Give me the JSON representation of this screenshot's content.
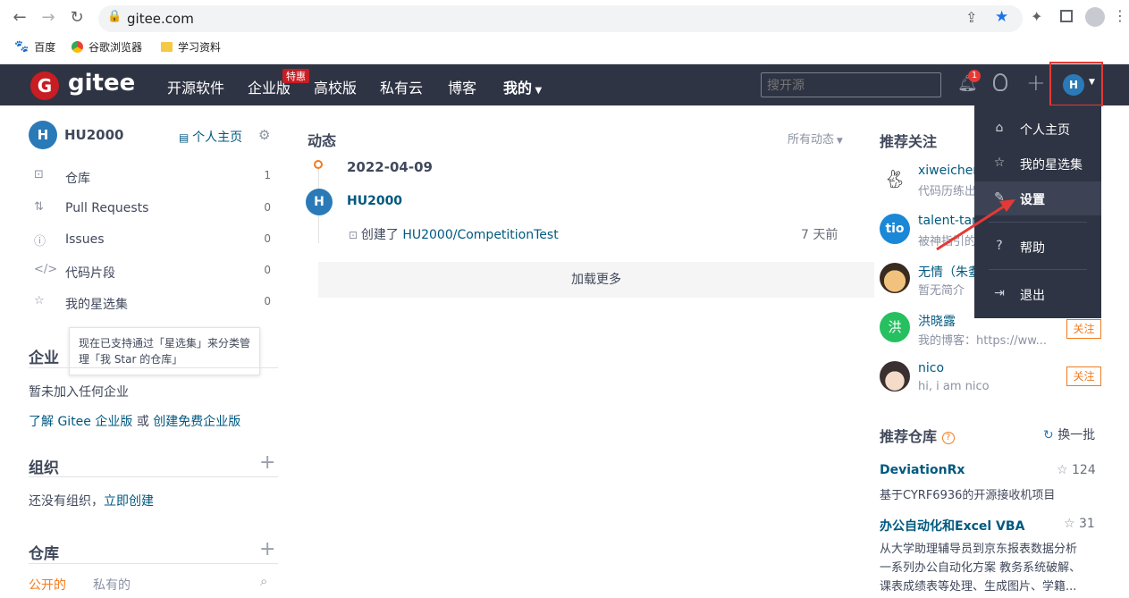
{
  "browser": {
    "url": "gitee.com",
    "bookmarks": [
      "百度",
      "谷歌浏览器",
      "学习资料"
    ]
  },
  "header": {
    "logo_text": "gitee",
    "nav": [
      "开源软件",
      "企业版",
      "高校版",
      "私有云",
      "博客",
      "我的"
    ],
    "promo_badge": "特惠",
    "search_placeholder": "搜开源",
    "notification_count": "1",
    "user_initial": "H"
  },
  "profile": {
    "initial": "H",
    "username": "HU2000",
    "home_link": "个人主页"
  },
  "sidebar": {
    "items": [
      {
        "icon": "repo-icon",
        "label": "仓库",
        "count": "1"
      },
      {
        "icon": "pull-request-icon",
        "label": "Pull Requests",
        "count": "0"
      },
      {
        "icon": "issue-icon",
        "label": "Issues",
        "count": "0"
      },
      {
        "icon": "code-icon",
        "label": "代码片段",
        "count": "0"
      },
      {
        "icon": "star-icon",
        "label": "我的星选集",
        "count": "0"
      }
    ],
    "tooltip": "现在已支持通过「星选集」来分类管理「我 Star 的仓库」",
    "enterprise_title": "企业",
    "enterprise_empty": "暂未加入任何企业",
    "enterprise_link1": "了解 Gitee 企业版",
    "enterprise_or": "或",
    "enterprise_link2": "创建免费企业版",
    "org_title": "组织",
    "org_empty": "还没有组织，",
    "org_link": "立即创建",
    "repo_title": "仓库",
    "repo_tab_public": "公开的",
    "repo_tab_private": "私有的"
  },
  "feed": {
    "title": "动态",
    "filter": "所有动态",
    "date": "2022-04-09",
    "user_initial": "H",
    "user": "HU2000",
    "action_prefix": "创建了",
    "action_repo": "HU2000/CompetitionTest",
    "time": "7 天前",
    "load_more": "加载更多"
  },
  "recommend_follow": {
    "title": "推荐关注",
    "users": [
      {
        "name": "xiweicheng",
        "desc": "代码历练出"
      },
      {
        "name": "talent-tan",
        "desc": "被神指引的"
      },
      {
        "name": "无情（朱耋",
        "desc": "暂无简介"
      },
      {
        "name": "洪晓露",
        "desc": "我的博客：https://ww..."
      },
      {
        "name": "nico",
        "desc": "hi, i am nico"
      }
    ],
    "follow_label": "关注",
    "hong_initial": "洪"
  },
  "recommend_repos": {
    "title": "推荐仓库",
    "refresh": "换一批",
    "repos": [
      {
        "name": "DeviationRx",
        "stars": "124",
        "desc": "基于CYRF6936的开源接收机项目"
      },
      {
        "name": "办公自动化和Excel VBA",
        "stars": "31",
        "desc_lines": [
          "从大学助理辅导员到京东报表数据分析",
          "一系列办公自动化方案 教务系统破解、",
          "课表成绩表等处理、生成图片、学籍..."
        ]
      }
    ]
  },
  "dropdown": {
    "items": [
      {
        "icon": "home-icon",
        "label": "个人主页"
      },
      {
        "icon": "star-icon",
        "label": "我的星选集"
      },
      {
        "icon": "edit-icon",
        "label": "设置"
      },
      {
        "icon": "help-icon",
        "label": "帮助"
      },
      {
        "icon": "logout-icon",
        "label": "退出"
      }
    ]
  },
  "colors": {
    "header_bg": "#2f3444",
    "link": "#005980",
    "accent_orange": "#f37b1d",
    "avatar_blue": "#2a7ab8",
    "highlight_red": "#e53935"
  }
}
